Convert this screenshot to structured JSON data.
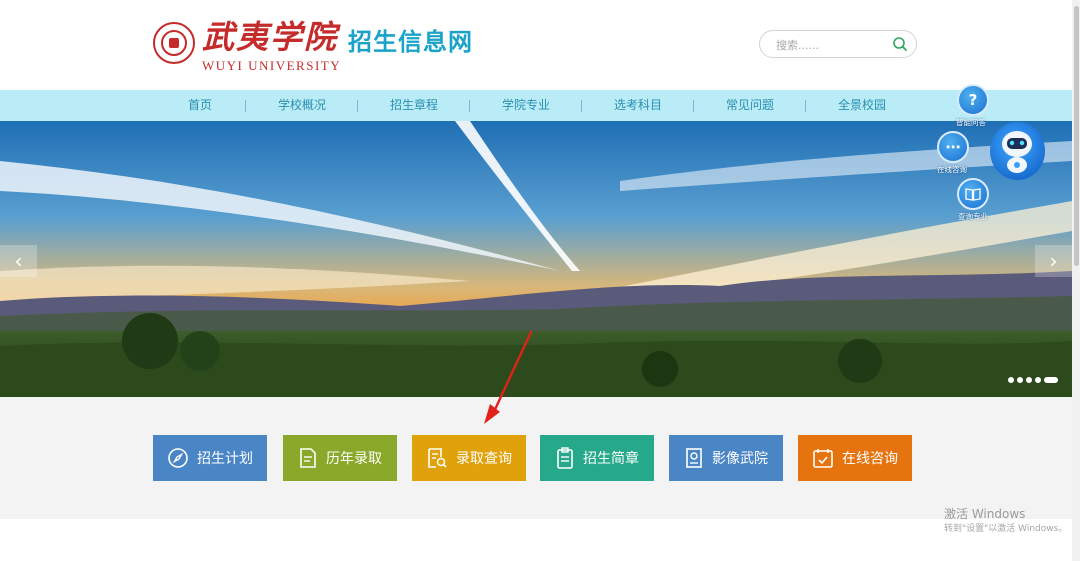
{
  "brand": {
    "name_cn": "武夷学院",
    "name_en": "WUYI UNIVERSITY",
    "site_title": "招生信息网"
  },
  "search": {
    "placeholder": "搜索......",
    "icon": "search-icon"
  },
  "nav": {
    "items": [
      "首页",
      "学校概况",
      "招生章程",
      "学院专业",
      "选考科目",
      "常见问题",
      "全景校园"
    ]
  },
  "floating": {
    "items": [
      {
        "label": "智能问答",
        "icon": "question-icon"
      },
      {
        "label": "在线咨询",
        "icon": "chat-icon"
      },
      {
        "label": "查询专业",
        "icon": "book-icon"
      }
    ],
    "robot_icon": "robot-icon"
  },
  "banner": {
    "prev": "‹",
    "next": "›",
    "slide_count": 5,
    "active_slide": 5
  },
  "quick_links": [
    {
      "label": "招生计划",
      "icon": "compass-icon",
      "color": "#4a86c5"
    },
    {
      "label": "历年录取",
      "icon": "document-icon",
      "color": "#8aa829"
    },
    {
      "label": "录取查询",
      "icon": "search-doc-icon",
      "color": "#e0a20a"
    },
    {
      "label": "招生简章",
      "icon": "clipboard-icon",
      "color": "#26a98a"
    },
    {
      "label": "影像武院",
      "icon": "portrait-icon",
      "color": "#4a86c5"
    },
    {
      "label": "在线咨询",
      "icon": "calendar-icon",
      "color": "#e5740f"
    }
  ],
  "watermark": {
    "line1": "激活 Windows",
    "line2": "转到\"设置\"以激活 Windows。"
  },
  "colors": {
    "nav_bg": "#b9ecf7",
    "title": "#1aa3c8",
    "brand_red": "#c62b2b"
  }
}
